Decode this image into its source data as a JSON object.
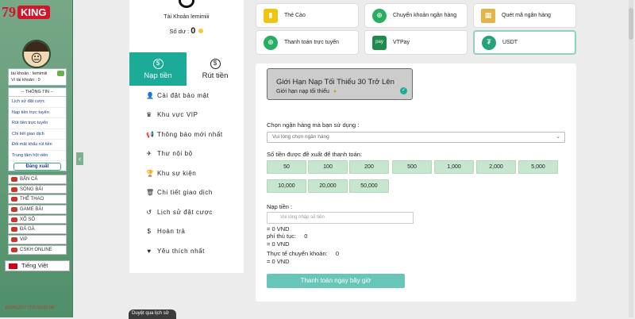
{
  "brand": {
    "logo_text": "79",
    "logo_sub": "KING"
  },
  "sidebar": {
    "account_label": "tài khoản : lemimiii",
    "wallet_label": "Ví tài khoản : 0",
    "menu_header": "-- THÔNG TIN --",
    "menu_items": [
      "Lịch sử đặt cược",
      "Nạp tiền trực tuyến",
      "Rút tiền trực tuyến",
      "Chi tiết giao dịch",
      "Đổi mật khẩu rút tiền",
      "Trung tâm hội viên"
    ],
    "logout_label": "Đăng xuất",
    "games": [
      {
        "label": "BẮN CÁ",
        "icon": "fish-icon"
      },
      {
        "label": "SÒNG BÀI",
        "icon": "casino-icon"
      },
      {
        "label": "THỂ THAO",
        "icon": "sports-icon"
      },
      {
        "label": "GAME BÀI",
        "icon": "cards-icon"
      },
      {
        "label": "XỔ SỐ",
        "icon": "lottery-icon"
      },
      {
        "label": "ĐÁ GÀ",
        "icon": "rooster-icon"
      },
      {
        "label": "VIP",
        "icon": "crown-icon"
      },
      {
        "label": "CSKH ONLINE",
        "icon": "support-icon"
      }
    ],
    "language": "Tiếng Việt",
    "timestamp": "2024/12/17 (T3) 00:02:08"
  },
  "account": {
    "name": "Tài Khoản lemimiii",
    "balance_label": "Số dư :",
    "balance_value": "0"
  },
  "tabs": [
    {
      "label": "Nạp tiền",
      "icon": "dollar-hand-icon",
      "active": true
    },
    {
      "label": "Rút tiền",
      "icon": "withdraw-hand-icon",
      "active": false
    }
  ],
  "nav": [
    {
      "label": "Cài đặt bảo mật",
      "icon": "user-lock-icon",
      "glyph": "👤"
    },
    {
      "label": "Khu vực VIP",
      "icon": "crown-icon",
      "glyph": "♛"
    },
    {
      "label": "Thông báo mới nhất",
      "icon": "megaphone-icon",
      "glyph": "📢"
    },
    {
      "label": "Thư nội bộ",
      "icon": "mail-icon",
      "glyph": "✈"
    },
    {
      "label": "Khu sự kiện",
      "icon": "trophy-icon",
      "glyph": "🏆"
    },
    {
      "label": "Chi tiết giao dịch",
      "icon": "trash-icon",
      "glyph": "🗑"
    },
    {
      "label": "Lịch sử đặt cược",
      "icon": "history-icon",
      "glyph": "↺"
    },
    {
      "label": "Hoàn trả",
      "icon": "coin-icon",
      "glyph": "$"
    },
    {
      "label": "Yêu thích nhất",
      "icon": "heart-icon",
      "glyph": "♥"
    }
  ],
  "methods": [
    {
      "label": "Thẻ Cào",
      "icon": "card-icon",
      "color": "#f1c40f"
    },
    {
      "label": "Chuyển khoản ngân hàng",
      "icon": "globe-icon",
      "color": "#27ae60"
    },
    {
      "label": "Quét mã ngân hàng",
      "icon": "qr-icon",
      "color": "#e2b44a"
    },
    {
      "label": "Thanh toán trực tuyến",
      "icon": "globe-icon",
      "color": "#27ae60"
    },
    {
      "label": "VTPay",
      "icon": "vtpay-icon",
      "color": "#1e8a4c"
    },
    {
      "label": "USDT",
      "icon": "tether-icon",
      "color": "#26a17b"
    }
  ],
  "limit": {
    "title": "Giới Hạn Nạp Tối Thiểu 30 Trở Lên",
    "subtitle": "Giới hạn nạp tối thiểu"
  },
  "form": {
    "bank_label": "Chọn ngân hàng mà bạn sử dụng :",
    "bank_placeholder": "Vui lòng chọn ngân hàng",
    "amount_label": "Số tiền được đề xuất để thanh toán:",
    "amounts": [
      "50",
      "100",
      "200",
      "500",
      "1,000",
      "2,000",
      "5,000",
      "10,000",
      "20,000",
      "50,000"
    ],
    "deposit_label": "Nạp tiền :",
    "deposit_placeholder": "Vui lòng nhập số tiền",
    "vnd1": "= 0 VND",
    "fee_label": "phí thủ tục:",
    "fee_value": "0",
    "vnd2": "= 0 VND",
    "actual_label": "Thực tế chuyển khoản:",
    "actual_value": "0",
    "vnd3": "= 0 VND",
    "submit_label": "Thanh toán ngay bây giờ"
  },
  "footer": {
    "history_tag": "Duyệt qua lịch sử"
  },
  "colors": {
    "accent": "#1bab97",
    "amount_bg": "#c7e6d0",
    "sidebar": "#5b9a76"
  }
}
